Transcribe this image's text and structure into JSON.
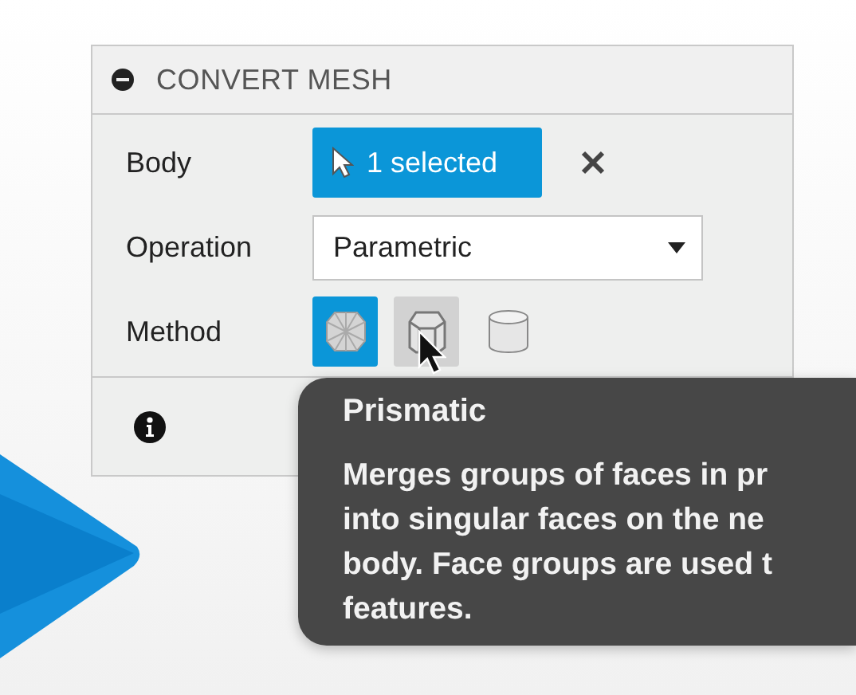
{
  "panel": {
    "title": "CONVERT MESH",
    "expanded": true
  },
  "rows": [
    {
      "kind": "selection",
      "label": "Body",
      "value": "1 selected"
    },
    {
      "kind": "dropdown",
      "label": "Operation",
      "value": "Parametric"
    },
    {
      "kind": "methods",
      "label": "Method",
      "options": [
        {
          "kind": "faceted",
          "selected": true,
          "hovered": false
        },
        {
          "kind": "prismatic",
          "selected": false,
          "hovered": true
        },
        {
          "kind": "cylinder",
          "selected": false,
          "hovered": false
        }
      ]
    }
  ],
  "tooltip": {
    "title": "Prismatic",
    "lines": [
      "Merges groups of faces in pr",
      "into singular faces on the ne",
      "body. Face groups are used t",
      "features."
    ]
  }
}
